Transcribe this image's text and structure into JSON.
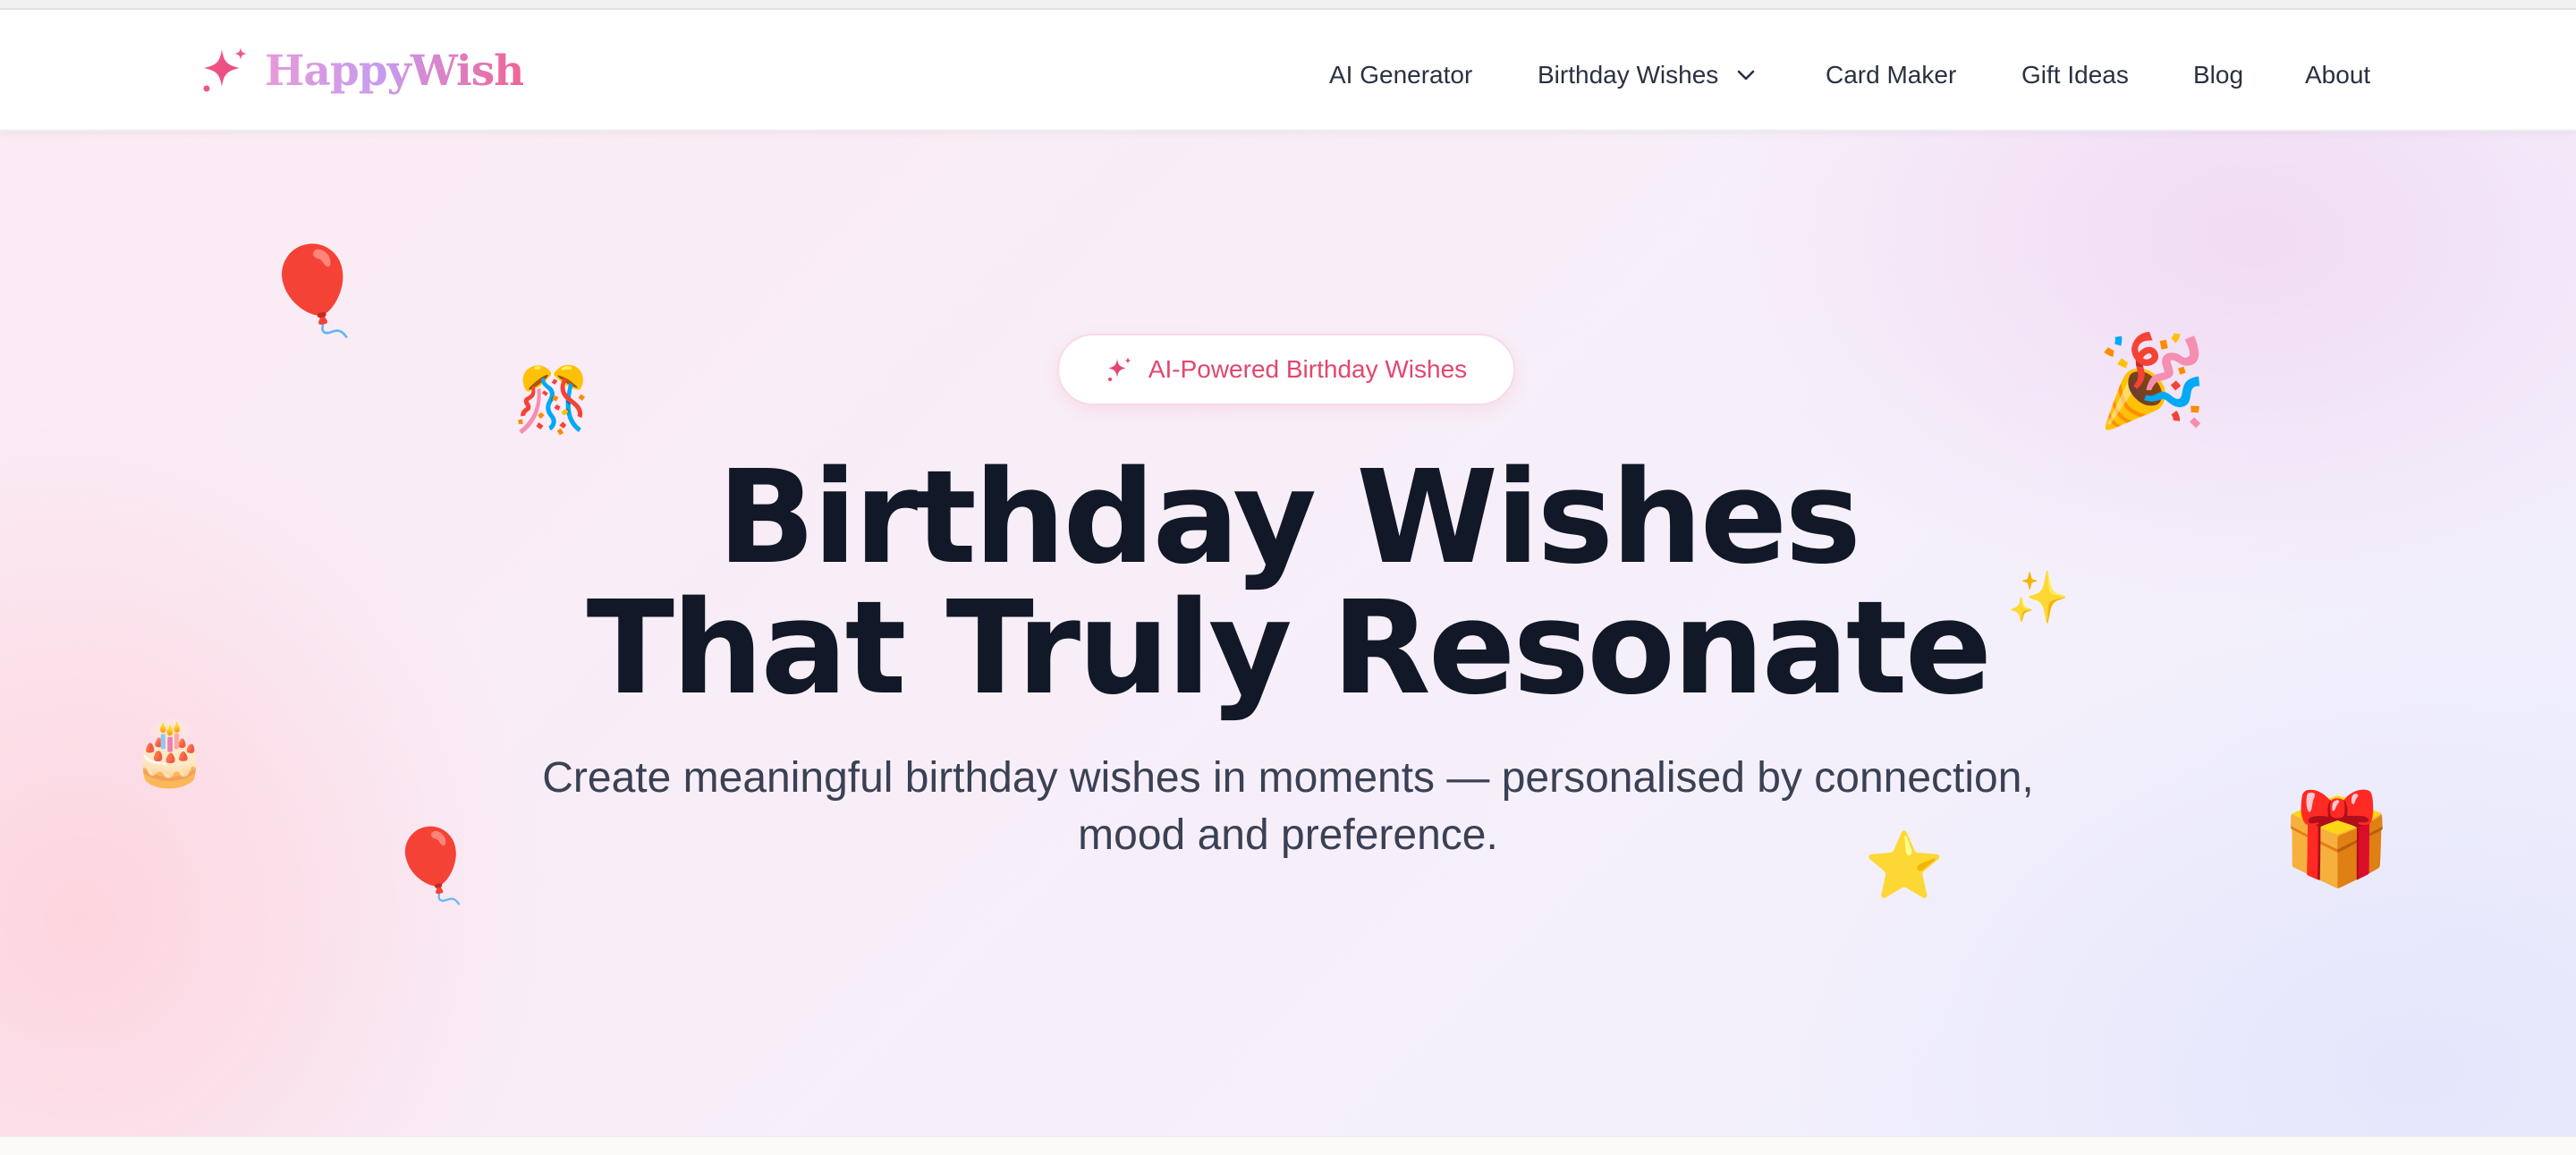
{
  "brand": {
    "name": "HappyWish",
    "icon": "sparkle-icon",
    "colors": {
      "pink": "#f06595",
      "lavender": "#c79bf0"
    }
  },
  "nav": {
    "items": [
      {
        "label": "AI Generator"
      },
      {
        "label": "Birthday Wishes",
        "icon": "chevron-down-icon"
      },
      {
        "label": "Card Maker"
      },
      {
        "label": "Gift Ideas"
      },
      {
        "label": "Blog"
      },
      {
        "label": "About"
      }
    ]
  },
  "hero": {
    "badge": {
      "icon": "sparkle-icon",
      "label": "AI-Powered Birthday Wishes"
    },
    "title_line1": "Birthday Wishes",
    "title_line2": "That Truly Resonate",
    "subtitle": "Create meaningful birthday wishes in moments — personalised by connection, mood and preference.",
    "decorations": [
      {
        "name": "balloon",
        "glyph": "🎈"
      },
      {
        "name": "confetti-ball",
        "glyph": "🎊"
      },
      {
        "name": "party-popper",
        "glyph": "🎉"
      },
      {
        "name": "sparkles",
        "glyph": "✨"
      },
      {
        "name": "birthday-cake",
        "glyph": "🎂"
      },
      {
        "name": "balloon",
        "glyph": "🎈"
      },
      {
        "name": "star",
        "glyph": "⭐"
      },
      {
        "name": "gift",
        "glyph": "🎁"
      }
    ]
  },
  "colors": {
    "title": "#111827",
    "accent": "#e3466e",
    "nav_text": "#2a3142"
  }
}
